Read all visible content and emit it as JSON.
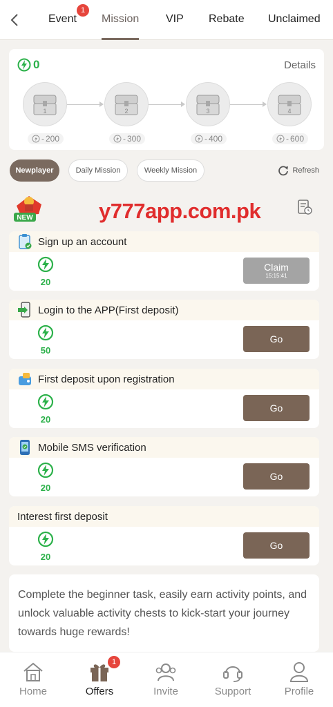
{
  "topnav": {
    "tabs": [
      {
        "label": "Event",
        "badge": "1"
      },
      {
        "label": "Mission"
      },
      {
        "label": "VIP"
      },
      {
        "label": "Rebate"
      },
      {
        "label": "Unclaimed"
      }
    ],
    "active_tab": "Mission"
  },
  "chests": {
    "points": "0",
    "details_label": "Details",
    "items": [
      {
        "number": "1",
        "cost": "200"
      },
      {
        "number": "2",
        "cost": "300"
      },
      {
        "number": "3",
        "cost": "400"
      },
      {
        "number": "4",
        "cost": "600"
      }
    ]
  },
  "filters": {
    "items": [
      "Newplayer",
      "Daily Mission",
      "Weekly Mission"
    ],
    "active": "Newplayer",
    "refresh_label": "Refresh"
  },
  "banner": {
    "new_label": "NEW",
    "watermark": "y777app.com.pk"
  },
  "tasks": [
    {
      "title": "Sign up an account",
      "reward": "20",
      "button": "Claim",
      "timer": "15:15:41",
      "icon": "clipboard-icon"
    },
    {
      "title": "Login to the APP(First deposit)",
      "reward": "50",
      "button": "Go",
      "icon": "phone-login-icon"
    },
    {
      "title": "First deposit upon registration",
      "reward": "20",
      "button": "Go",
      "icon": "wallet-icon"
    },
    {
      "title": "Mobile SMS verification",
      "reward": "20",
      "button": "Go",
      "icon": "mobile-icon"
    },
    {
      "title": "Interest first deposit",
      "reward": "20",
      "button": "Go",
      "icon": ""
    }
  ],
  "description": "Complete the beginner task, easily earn activity points, and unlock valuable activity chests to kick-start your journey towards huge rewards!",
  "bottomnav": {
    "items": [
      {
        "label": "Home",
        "icon": "home-icon"
      },
      {
        "label": "Offers",
        "icon": "gift-icon",
        "badge": "1"
      },
      {
        "label": "Invite",
        "icon": "invite-icon"
      },
      {
        "label": "Support",
        "icon": "headset-icon"
      },
      {
        "label": "Profile",
        "icon": "profile-icon"
      }
    ],
    "active": "Offers"
  },
  "colors": {
    "accent_brown": "#7a6556",
    "reward_green": "#2cb14a",
    "badge_red": "#e6453c",
    "watermark_red": "#e02d2d"
  }
}
